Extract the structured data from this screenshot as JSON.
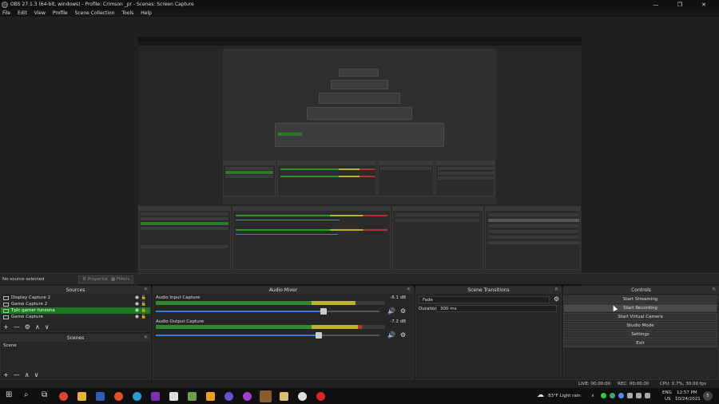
{
  "window": {
    "title": "OBS 27.1.3 (64-bit, windows) - Profile: Crimson _pr - Scenes: Screen Capture",
    "controls": {
      "minimize": "—",
      "maximize": "❐",
      "close": "✕"
    }
  },
  "menu": [
    "File",
    "Edit",
    "View",
    "Profile",
    "Scene Collection",
    "Tools",
    "Help"
  ],
  "source_toolbar": {
    "status": "No source selected",
    "properties": "Properties",
    "filters": "Filters"
  },
  "sources": {
    "title": "Sources",
    "items": [
      {
        "label": "Display Capture 2",
        "selected": false
      },
      {
        "label": "Game Capture 2",
        "selected": false
      },
      {
        "label": "Tplc gamer funsona",
        "selected": true
      },
      {
        "label": "Game Capture",
        "selected": false
      }
    ],
    "tools": [
      "+",
      "—",
      "⚙",
      "∧",
      "∨"
    ]
  },
  "scenes": {
    "title": "Scenes",
    "items": [
      "Scene"
    ],
    "tools": [
      "+",
      "—",
      "∧",
      "∨"
    ]
  },
  "mixer": {
    "title": "Audio Mixer",
    "tracks": [
      {
        "label": "Audio Input Capture",
        "db": "-6.1 dB",
        "level": 0.87,
        "volume": 0.75
      },
      {
        "label": "Audio Output Capture",
        "db": "-7.2 dB",
        "level": 0.9,
        "volume": 0.73
      }
    ]
  },
  "transitions": {
    "title": "Scene Transitions",
    "type": "Fade",
    "duration_label": "Duration",
    "duration": "300 ms"
  },
  "controls": {
    "title": "Controls",
    "buttons": [
      "Start Streaming",
      "Start Recording",
      "Start Virtual Camera",
      "Studio Mode",
      "Settings",
      "Exit"
    ]
  },
  "status": {
    "live": "LIVE: 00:00:00",
    "rec": "REC: 00:00:00",
    "cpu": "CPU: 0.7%, 30.00 fps"
  },
  "taskbar": {
    "weather": "83°F  Light rain",
    "lang": "ENG",
    "region": "US",
    "time": "12:57 PM",
    "date": "10/24/2021",
    "notif": "5"
  },
  "colors": {
    "selected_green": "#1e7a1e",
    "meter_green": "#2f8a2f",
    "meter_yellow": "#b8b42d",
    "meter_red": "#b83232",
    "volume_blue": "#3f7ed0"
  }
}
